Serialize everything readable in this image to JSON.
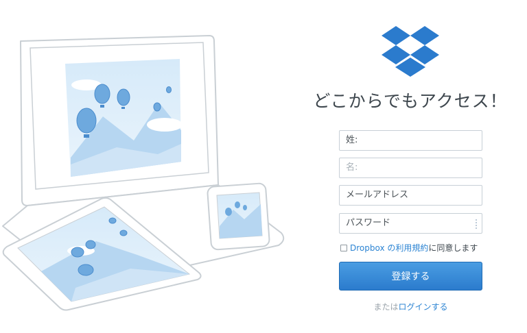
{
  "headline": "どこからでもアクセス！",
  "form": {
    "first_name": "姓:",
    "last_name_placeholder": "名:",
    "email": "メールアドレス",
    "password": "パスワード"
  },
  "terms": {
    "link": "Dropbox の利用規約",
    "suffix": "に同意します"
  },
  "register_label": "登録する",
  "login": {
    "prefix": "または",
    "link": "ログインする"
  },
  "colors": {
    "brand": "#2b7bcd",
    "link": "#2c84d3",
    "text": "#3d464d"
  },
  "icons": {
    "logo": "dropbox-logo",
    "password_manager": "key-dots-icon"
  }
}
